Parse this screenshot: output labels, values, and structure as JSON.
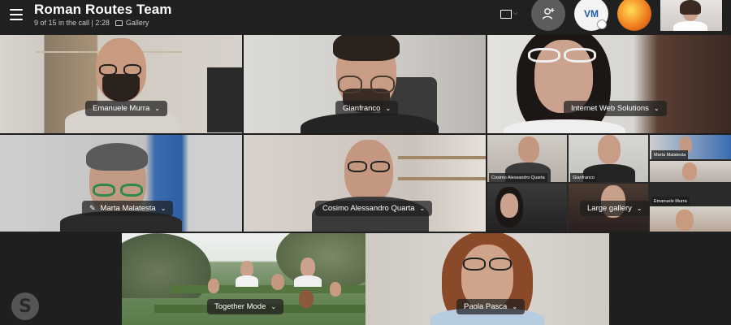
{
  "header": {
    "title": "Roman Routes Team",
    "status": "9 of 15 in the call | 2:28",
    "view": "Gallery",
    "avatar_initials": "VM"
  },
  "tiles": {
    "t1": "Emanuele Murra",
    "t2": "Gianfranco",
    "t3": "Internet Web Solutions",
    "t4": "Marta Malatesta",
    "t5": "Cosimo Alessandro Quarta",
    "t6": "Large gallery",
    "t7": "Together Mode",
    "t8": "Paola Pasca"
  },
  "mini_tiles": {
    "m1": "Cosimo Alessandro Quarta",
    "m2": "Gianfranco",
    "m3": "Marta Malatesta",
    "m4": "Emanuele Murra"
  },
  "icons": {
    "menu": "hamburger-icon",
    "layout": "gallery-layout-icon",
    "add": "add-person-icon",
    "mute": "mic-off-icon",
    "brand": "skype-logo"
  }
}
